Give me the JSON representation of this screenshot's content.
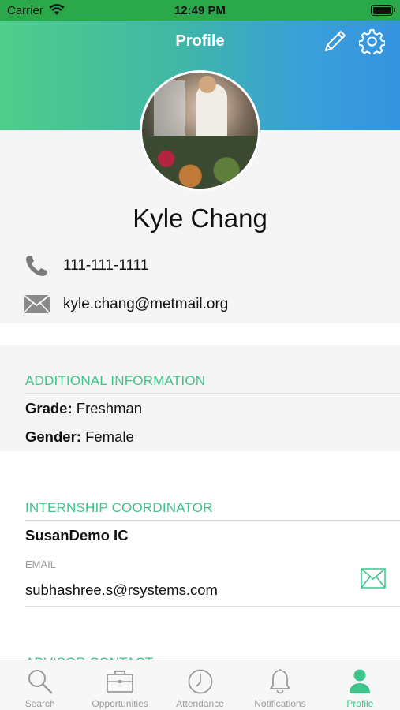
{
  "status_bar": {
    "carrier": "Carrier",
    "time": "12:49 PM"
  },
  "header": {
    "title": "Profile",
    "edit_icon": "pencil-icon",
    "settings_icon": "gear-icon"
  },
  "profile": {
    "name": "Kyle Chang",
    "phone": "111-111-1111",
    "email": "kyle.chang@metmail.org"
  },
  "additional_information": {
    "title": "ADDITIONAL INFORMATION",
    "grade_label": "Grade:",
    "grade_value": "Freshman",
    "gender_label": "Gender:",
    "gender_value": "Female"
  },
  "internship_coordinator": {
    "title": "INTERNSHIP COORDINATOR",
    "name": "SusanDemo IC",
    "email_label": "EMAIL",
    "email_value": "subhashree.s@rsystems.com"
  },
  "advisor_contact": {
    "title": "ADVISOR CONTACT"
  },
  "tab_bar": {
    "items": [
      {
        "label": "Search",
        "icon": "search-icon",
        "active": false
      },
      {
        "label": "Opportunities",
        "icon": "briefcase-icon",
        "active": false
      },
      {
        "label": "Attendance",
        "icon": "clock-icon",
        "active": false
      },
      {
        "label": "Notifications",
        "icon": "bell-icon",
        "active": false
      },
      {
        "label": "Profile",
        "icon": "person-icon",
        "active": true
      }
    ]
  },
  "colors": {
    "accent": "#3dc48a",
    "status_bar": "#2aa84a",
    "gradient_start": "#4fcd8a",
    "gradient_end": "#3593e0"
  }
}
